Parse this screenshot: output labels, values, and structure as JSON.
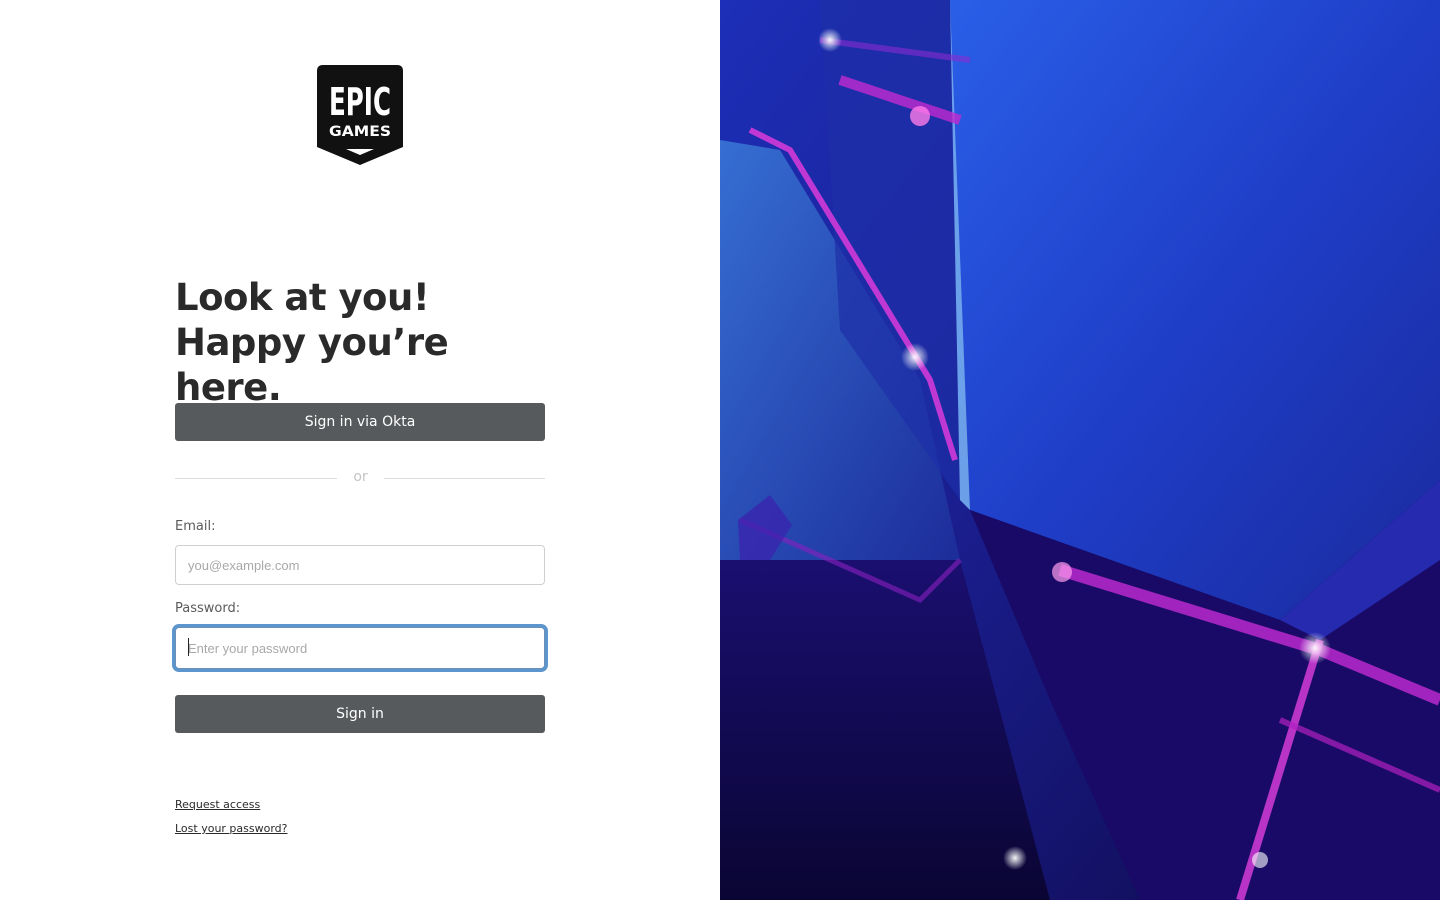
{
  "logo": {
    "line1": "EPIC",
    "line2": "GAMES"
  },
  "headline": {
    "line1": "Look at you!",
    "line2": "Happy you’re here."
  },
  "okta_button": {
    "label": "Sign in via Okta"
  },
  "divider": {
    "text": "or"
  },
  "email": {
    "label": "Email:",
    "placeholder": "you@example.com",
    "value": ""
  },
  "password": {
    "label": "Password:",
    "placeholder": "Enter your password",
    "value": ""
  },
  "signin_button": {
    "label": "Sign in"
  },
  "links": {
    "request_access": "Request access",
    "lost_password": "Lost your password?"
  },
  "colors": {
    "button_bg": "#575a5c",
    "heading": "#2a2a2a",
    "focus_ring": "#5d96cf",
    "hero_blue": "#1b2fd6",
    "hero_magenta": "#c81fd0"
  }
}
